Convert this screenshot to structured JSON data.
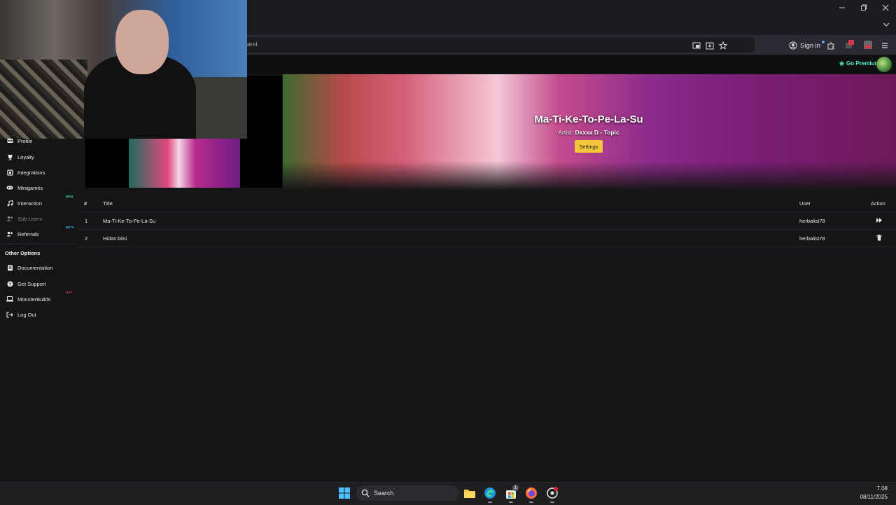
{
  "browser": {
    "url_text": "uest",
    "sign_in_label": "Sign in",
    "window_buttons": [
      "minimize",
      "restore",
      "close"
    ]
  },
  "header": {
    "premium_label": "Go Premium"
  },
  "banner": {
    "title": "Ma-Ti-Ke-To-Pe-La-Su",
    "artist_label": "Artist:",
    "artist_name": "Dxxxa D - Topic",
    "settings_label": "Settings"
  },
  "sidebar": {
    "items": [
      {
        "label": "Profile",
        "icon": "id-card-icon"
      },
      {
        "label": "Loyalty",
        "icon": "trophy-icon"
      },
      {
        "label": "Integrations",
        "icon": "plugin-icon"
      },
      {
        "label": "Minigames",
        "icon": "gamepad-icon"
      },
      {
        "label": "Interaction",
        "icon": "music-note-icon",
        "badge": "NEW",
        "badge_color": "#3ddc84"
      },
      {
        "label": "Sub-Users",
        "icon": "users-icon",
        "disabled": true
      },
      {
        "label": "Referrals",
        "icon": "users-icon",
        "badge": "BETA",
        "badge_color": "#3aa8d8"
      }
    ],
    "other_heading": "Other Options",
    "other_items": [
      {
        "label": "Documentation",
        "icon": "document-icon"
      },
      {
        "label": "Get Support",
        "icon": "question-icon"
      },
      {
        "label": "MonsterBuilds",
        "icon": "laptop-icon",
        "badge": "HOT",
        "badge_color": "#d8344a"
      },
      {
        "label": "Log Out",
        "icon": "logout-icon"
      }
    ]
  },
  "table": {
    "headers": {
      "num": "#",
      "title": "Title",
      "user": "User",
      "action": "Action"
    },
    "rows": [
      {
        "num": "1",
        "title": "Ma-Ti-Ke-To-Pe-La-Su",
        "user": "herbalist78",
        "action": "fast-forward-icon"
      },
      {
        "num": "2",
        "title": "Hidas bilsi",
        "user": "herbalist78",
        "action": "trash-icon"
      }
    ]
  },
  "taskbar": {
    "search_label": "Search",
    "store_badge": "1",
    "time": "7.08",
    "date": "08/11/2025"
  },
  "colors": {
    "accent_yellow": "#f3c63b",
    "premium_green": "#41e0b8",
    "background": "#151517"
  }
}
